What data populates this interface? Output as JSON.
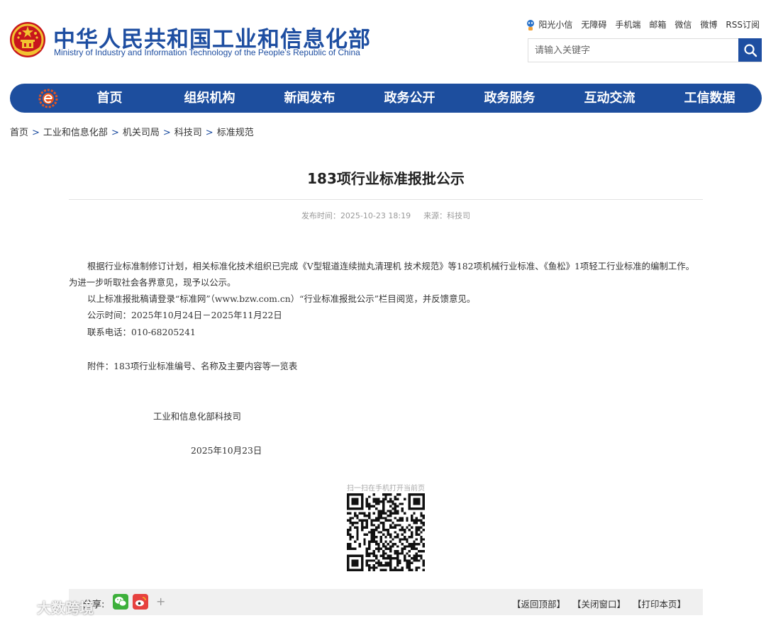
{
  "header": {
    "title_cn": "中华人民共和国工业和信息化部",
    "title_en": "Ministry of Industry and Information Technology of the People’s Republic of China",
    "top_links": [
      "阳光小信",
      "无障碍",
      "手机端",
      "邮箱",
      "微信",
      "微博",
      "RSS订阅"
    ],
    "search_placeholder": "请输入关键字"
  },
  "nav": {
    "items": [
      "首页",
      "组织机构",
      "新闻发布",
      "政务公开",
      "政务服务",
      "互动交流",
      "工信数据"
    ]
  },
  "breadcrumb": [
    "首页",
    "工业和信息化部",
    "机关司局",
    "科技司",
    "标准规范"
  ],
  "article": {
    "title": "183项行业标准报批公示",
    "publish_label": "发布时间：",
    "publish_time": "2025-10-23 18:19",
    "source_label": "来源：",
    "source": "科技司",
    "paragraph1": "根据行业标准制修订计划，相关标准化技术组织已完成《V型辊道连续抛丸清理机 技术规范》等182项机械行业标准、《鱼松》1项轻工行业标准的编制工作。为进一步听取社会各界意见，现予以公示。",
    "paragraph2": "以上标准报批稿请登录“标准网”（www.bzw.com.cn）“行业标准报批公示”栏目阅览，并反馈意见。",
    "period": "公示时间：2025年10月24日－2025年11月22日",
    "phone": "联系电话：010-68205241",
    "attachment": "附件：183项行业标准编号、名称及主要内容等一览表",
    "signature": "工业和信息化部科技司",
    "date": "2025年10月23日"
  },
  "qr": {
    "label": "扫一扫在手机打开当前页"
  },
  "footer": {
    "share_label": "分享:",
    "plus": "+",
    "links": [
      "【返回顶部】",
      "【关闭窗口】",
      "【打印本页】"
    ]
  },
  "watermark": "大数跨境",
  "colors": {
    "brand_blue": "#1d4e9e",
    "wechat_green": "#3db03b",
    "weibo_red": "#e6413f"
  }
}
